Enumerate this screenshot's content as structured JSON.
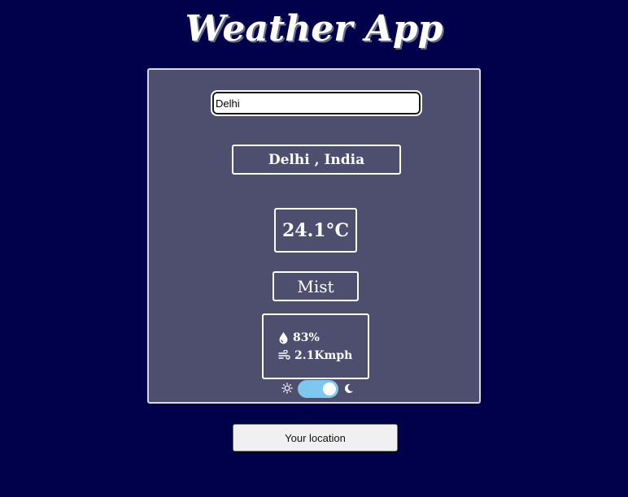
{
  "header": {
    "title": "Weather App"
  },
  "search": {
    "value": "Delhi",
    "placeholder": ""
  },
  "weather": {
    "location": "Delhi , India",
    "temperature": "24.1°C",
    "condition": "Mist",
    "humidity": "83%",
    "wind": "2.1Kmph"
  },
  "theme_toggle": {
    "state": "on",
    "left_icon": "sun-icon",
    "right_icon": "moon-icon",
    "track_color": "#7ec8ef"
  },
  "actions": {
    "location_button_label": "Your location"
  },
  "colors": {
    "background": "#01004a",
    "card": "#4e4f6f",
    "text": "#ffffff"
  }
}
